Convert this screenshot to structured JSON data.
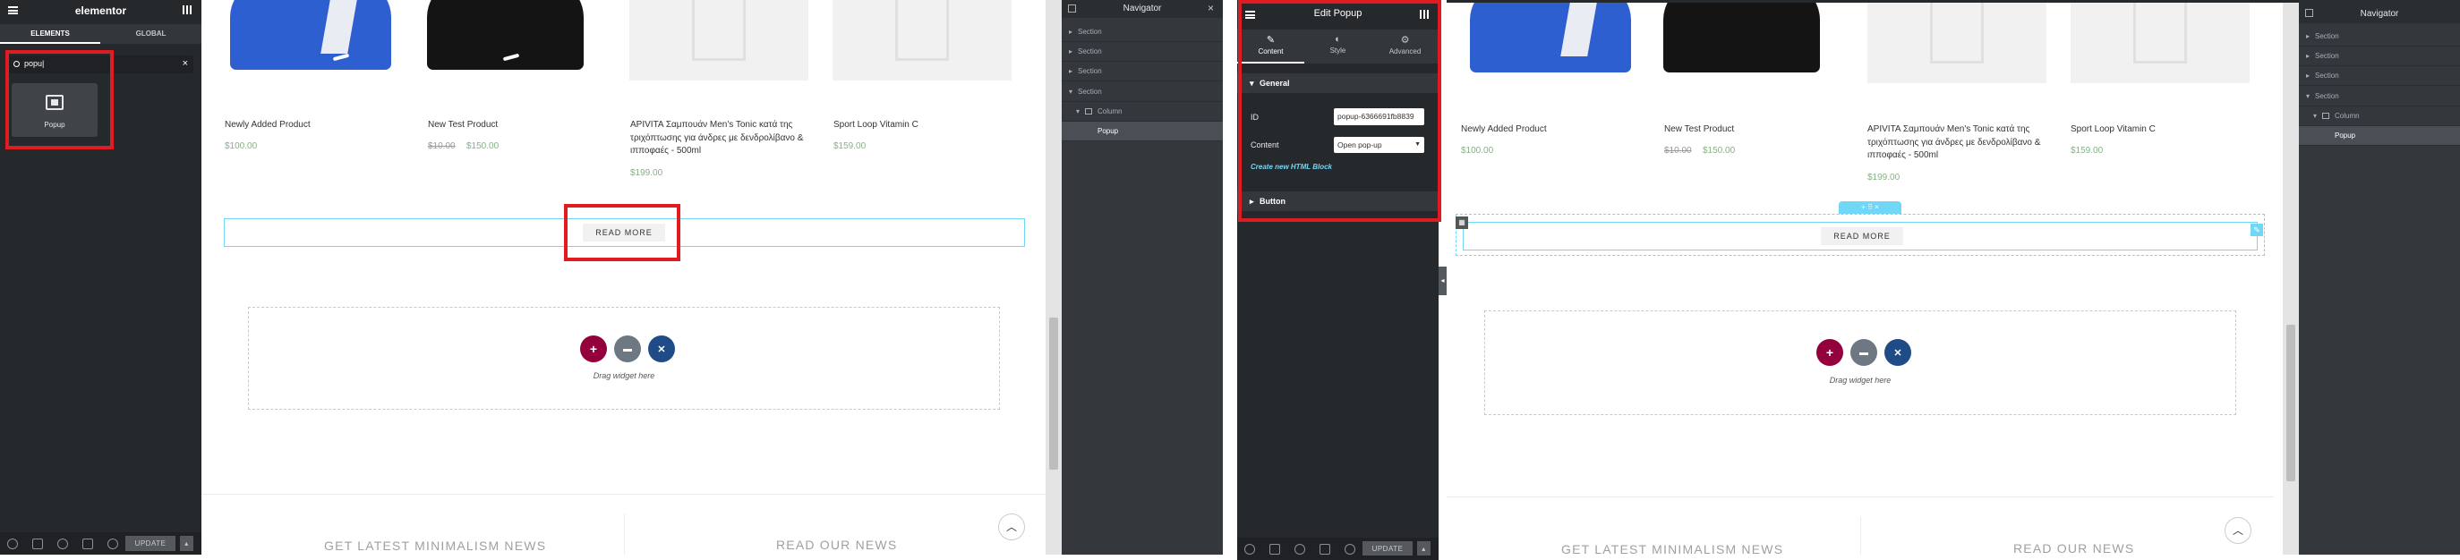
{
  "left": {
    "panel": {
      "brand": "elementor",
      "tab_elements": "ELEMENTS",
      "tab_global": "GLOBAL",
      "search_value": "popu|",
      "widget_label": "Popup",
      "update": "UPDATE"
    },
    "products": [
      {
        "name": "Newly Added Product",
        "price": "$100.00",
        "sale": ""
      },
      {
        "name": "New Test Product",
        "price": "$10.00",
        "sale": "$150.00"
      },
      {
        "name": "APIVITA Σαμπουάν Men's Tonic κατά της τριχόπτωσης για άνδρες με δενδρολίβανο & ιπποφαές - 500ml",
        "price": "$199.00",
        "sale": ""
      },
      {
        "name": "Sport Loop Vitamin C",
        "price": "$159.00",
        "sale": ""
      }
    ],
    "read_more": "READ MORE",
    "drag_widget": "Drag widget here",
    "footer_news": "GET LATEST MINIMALISM NEWS",
    "footer_read": "READ OUR NEWS",
    "navigator": {
      "title": "Navigator",
      "items": [
        "Section",
        "Section",
        "Section",
        "Section",
        "Column",
        "Popup"
      ]
    }
  },
  "right": {
    "panel": {
      "title": "Edit Popup",
      "tab_content": "Content",
      "tab_style": "Style",
      "tab_advanced": "Advanced",
      "section_general": "General",
      "id_label": "ID",
      "id_value": "popup-6366691fb8839",
      "content_label": "Content",
      "content_value": "Open pop-up",
      "create_link": "Create new HTML Block",
      "section_button": "Button",
      "update": "UPDATE"
    },
    "products": [
      {
        "name": "Newly Added Product",
        "price": "$100.00",
        "sale": ""
      },
      {
        "name": "New Test Product",
        "price": "$10.00",
        "sale": "$150.00"
      },
      {
        "name": "APIVITA Σαμπουάν Men's Tonic κατά της τριχόπτωσης για άνδρες με δενδρολίβανο & ιπποφαές - 500ml",
        "price": "$199.00",
        "sale": ""
      },
      {
        "name": "Sport Loop Vitamin C",
        "price": "$159.00",
        "sale": ""
      }
    ],
    "read_more": "READ MORE",
    "drag_widget": "Drag widget here",
    "footer_news": "GET LATEST MINIMALISM NEWS",
    "footer_read": "READ OUR NEWS",
    "navigator": {
      "title": "Navigator",
      "items": [
        "Section",
        "Section",
        "Section",
        "Section",
        "Column",
        "Popup"
      ]
    }
  },
  "colors": {
    "panel": "#26292c",
    "accent_red": "#e11b22",
    "elementor_pink": "#93003c",
    "price_green": "#86b085",
    "link_blue": "#71d7f7"
  }
}
